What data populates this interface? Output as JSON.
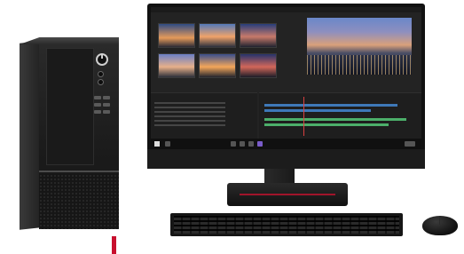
{
  "scene": {
    "subject": "desktop-computer-set",
    "colors": {
      "background": "#ffffff",
      "accent_red": "#c8102e",
      "timeline_blue": "#3e78b8",
      "timeline_green": "#4caf6a"
    }
  },
  "monitor": {
    "app": "video-editor",
    "thumbnail_count": 6,
    "taskbar_icons": [
      "windows-logo-icon",
      "search-icon",
      "taskview-icon",
      "folder-icon",
      "browser-icon",
      "premiere-icon",
      "clock-icon"
    ]
  }
}
